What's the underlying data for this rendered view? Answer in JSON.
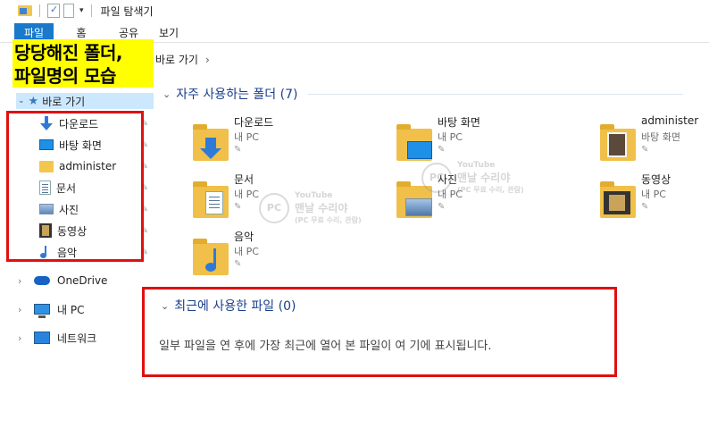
{
  "titlebar": {
    "title": "파일 탐색기"
  },
  "ribbon": {
    "tabs": [
      "파일",
      "홈",
      "공유",
      "보기"
    ]
  },
  "address": {
    "path": "바로 가기"
  },
  "highlight_label": {
    "line1": "당당해진 폴더,",
    "line2": "파일명의 모습"
  },
  "nav": {
    "quick_access": "바로 가기",
    "items": [
      "다운로드",
      "바탕 화면",
      "administer",
      "문서",
      "사진",
      "동영상",
      "음악"
    ],
    "roots": [
      "OneDrive",
      "내 PC",
      "네트워크"
    ]
  },
  "frequent": {
    "title": "자주 사용하는 폴더 (7)",
    "tiles": [
      {
        "name": "다운로드",
        "loc": "내 PC"
      },
      {
        "name": "바탕 화면",
        "loc": "내 PC"
      },
      {
        "name": "administer",
        "loc": "바탕 화면"
      },
      {
        "name": "문서",
        "loc": "내 PC"
      },
      {
        "name": "사진",
        "loc": "내 PC"
      },
      {
        "name": "동영상",
        "loc": "내 PC"
      },
      {
        "name": "음악",
        "loc": "내 PC"
      }
    ]
  },
  "recent": {
    "title": "최근에 사용한 파일 (0)",
    "empty_message": "일부 파일을 연 후에 가장 최근에 열어 본 파일이 여 기에 표시됩니다."
  },
  "watermark": {
    "brand": "맨날 수리야",
    "sub": "(PC 무료 수리, 관람)",
    "badge": "YouTube",
    "logo": "PC"
  },
  "colors": {
    "accent": "#1979ca",
    "highlight": "#ffff00",
    "redbox": "#e01010",
    "section": "#1a3f8c"
  }
}
